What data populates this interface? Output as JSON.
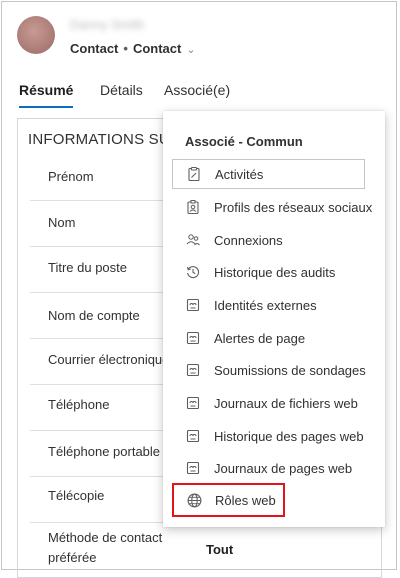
{
  "record": {
    "name": "Danny Smith",
    "entity_type": "Contact",
    "form_name": "Contact"
  },
  "tabs": [
    {
      "label": "Résumé",
      "active": true
    },
    {
      "label": "Détails",
      "active": false
    },
    {
      "label": "Associé(e)",
      "active": false
    }
  ],
  "section": {
    "title": "INFORMATIONS SU"
  },
  "fields": [
    {
      "label": "Prénom"
    },
    {
      "label": "Nom"
    },
    {
      "label": "Titre du poste"
    },
    {
      "label": "Nom de compte"
    },
    {
      "label": "Courrier électronique"
    },
    {
      "label": "Téléphone"
    },
    {
      "label": "Téléphone portable"
    },
    {
      "label": "Télécopie"
    },
    {
      "label": "Méthode de contact préférée",
      "value": "Tout"
    }
  ],
  "related_menu": {
    "header": "Associé - Commun",
    "items": [
      {
        "label": "Activités",
        "icon": "clipboard-icon"
      },
      {
        "label": "Profils des réseaux sociaux",
        "icon": "social-profile-icon"
      },
      {
        "label": "Connexions",
        "icon": "people-icon"
      },
      {
        "label": "Historique des audits",
        "icon": "history-icon"
      },
      {
        "label": "Identités externes",
        "icon": "puzzle-icon"
      },
      {
        "label": "Alertes de page",
        "icon": "puzzle-icon"
      },
      {
        "label": "Soumissions de sondages",
        "icon": "puzzle-icon"
      },
      {
        "label": "Journaux de fichiers web",
        "icon": "puzzle-icon"
      },
      {
        "label": "Historique des pages web",
        "icon": "puzzle-icon"
      },
      {
        "label": "Journaux de pages web",
        "icon": "puzzle-icon"
      },
      {
        "label": "Rôles web",
        "icon": "globe-icon"
      }
    ]
  },
  "colors": {
    "accent": "#0f6cbd",
    "highlight": "#e0151c"
  }
}
